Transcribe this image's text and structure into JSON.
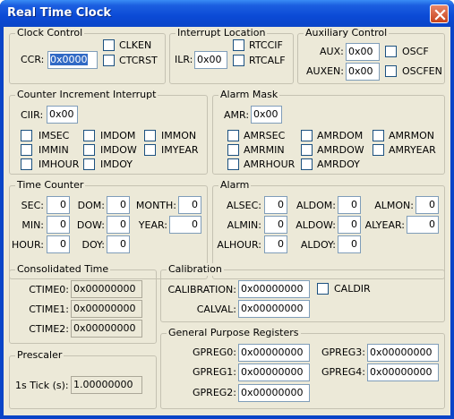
{
  "window": {
    "title": "Real Time Clock"
  },
  "clock_control": {
    "title": "Clock Control",
    "ccr_label": "CCR:",
    "ccr_value": "0x0000",
    "clken": "CLKEN",
    "ctcrst": "CTCRST"
  },
  "interrupt_location": {
    "title": "Interrupt Location",
    "ilr_label": "ILR:",
    "ilr_value": "0x00",
    "rtccif": "RTCCIF",
    "rtccalf": "RTCALF"
  },
  "auxiliary_control": {
    "title": "Auxiliary Control",
    "aux_label": "AUX:",
    "aux_value": "0x00",
    "oscf": "OSCF",
    "auxen_label": "AUXEN:",
    "auxen_value": "0x00",
    "oscfen": "OSCFEN"
  },
  "counter_increment": {
    "title": "Counter Increment Interrupt",
    "ciir_label": "CIIR:",
    "ciir_value": "0x00",
    "imsec": "IMSEC",
    "immin": "IMMIN",
    "imhour": "IMHOUR",
    "imdom": "IMDOM",
    "imdow": "IMDOW",
    "imdoy": "IMDOY",
    "immon": "IMMON",
    "imyear": "IMYEAR"
  },
  "alarm_mask": {
    "title": "Alarm Mask",
    "amr_label": "AMR:",
    "amr_value": "0x00",
    "amrsec": "AMRSEC",
    "amrmin": "AMRMIN",
    "amrhour": "AMRHOUR",
    "amrdom": "AMRDOM",
    "amrdow": "AMRDOW",
    "amrdoy": "AMRDOY",
    "amrmon": "AMRMON",
    "amryear": "AMRYEAR"
  },
  "time_counter": {
    "title": "Time Counter",
    "sec_label": "SEC:",
    "sec": "0",
    "min_label": "MIN:",
    "min": "0",
    "hour_label": "HOUR:",
    "hour": "0",
    "dom_label": "DOM:",
    "dom": "0",
    "dow_label": "DOW:",
    "dow": "0",
    "doy_label": "DOY:",
    "doy": "0",
    "month_label": "MONTH:",
    "month": "0",
    "year_label": "YEAR:",
    "year": "0"
  },
  "alarm": {
    "title": "Alarm",
    "alsec_label": "ALSEC:",
    "alsec": "0",
    "almin_label": "ALMIN:",
    "almin": "0",
    "alhour_label": "ALHOUR:",
    "alhour": "0",
    "aldom_label": "ALDOM:",
    "aldom": "0",
    "aldow_label": "ALDOW:",
    "aldow": "0",
    "aldoy_label": "ALDOY:",
    "aldoy": "0",
    "almon_label": "ALMON:",
    "almon": "0",
    "alyear_label": "ALYEAR:",
    "alyear": "0"
  },
  "consolidated_time": {
    "title": "Consolidated Time",
    "ctime0_label": "CTIME0:",
    "ctime0": "0x00000000",
    "ctime1_label": "CTIME1:",
    "ctime1": "0x00000000",
    "ctime2_label": "CTIME2:",
    "ctime2": "0x00000000"
  },
  "prescaler": {
    "title": "Prescaler",
    "tick_label": "1s Tick (s):",
    "tick": "1.00000000"
  },
  "calibration": {
    "title": "Calibration",
    "calibration_label": "CALIBRATION:",
    "calibration": "0x00000000",
    "caldir": "CALDIR",
    "calval_label": "CALVAL:",
    "calval": "0x00000000"
  },
  "gpreg": {
    "title": "General Purpose Registers",
    "gpreg0_label": "GPREG0:",
    "gpreg0": "0x00000000",
    "gpreg1_label": "GPREG1:",
    "gpreg1": "0x00000000",
    "gpreg2_label": "GPREG2:",
    "gpreg2": "0x00000000",
    "gpreg3_label": "GPREG3:",
    "gpreg3": "0x00000000",
    "gpreg4_label": "GPREG4:",
    "gpreg4": "0x00000000"
  }
}
